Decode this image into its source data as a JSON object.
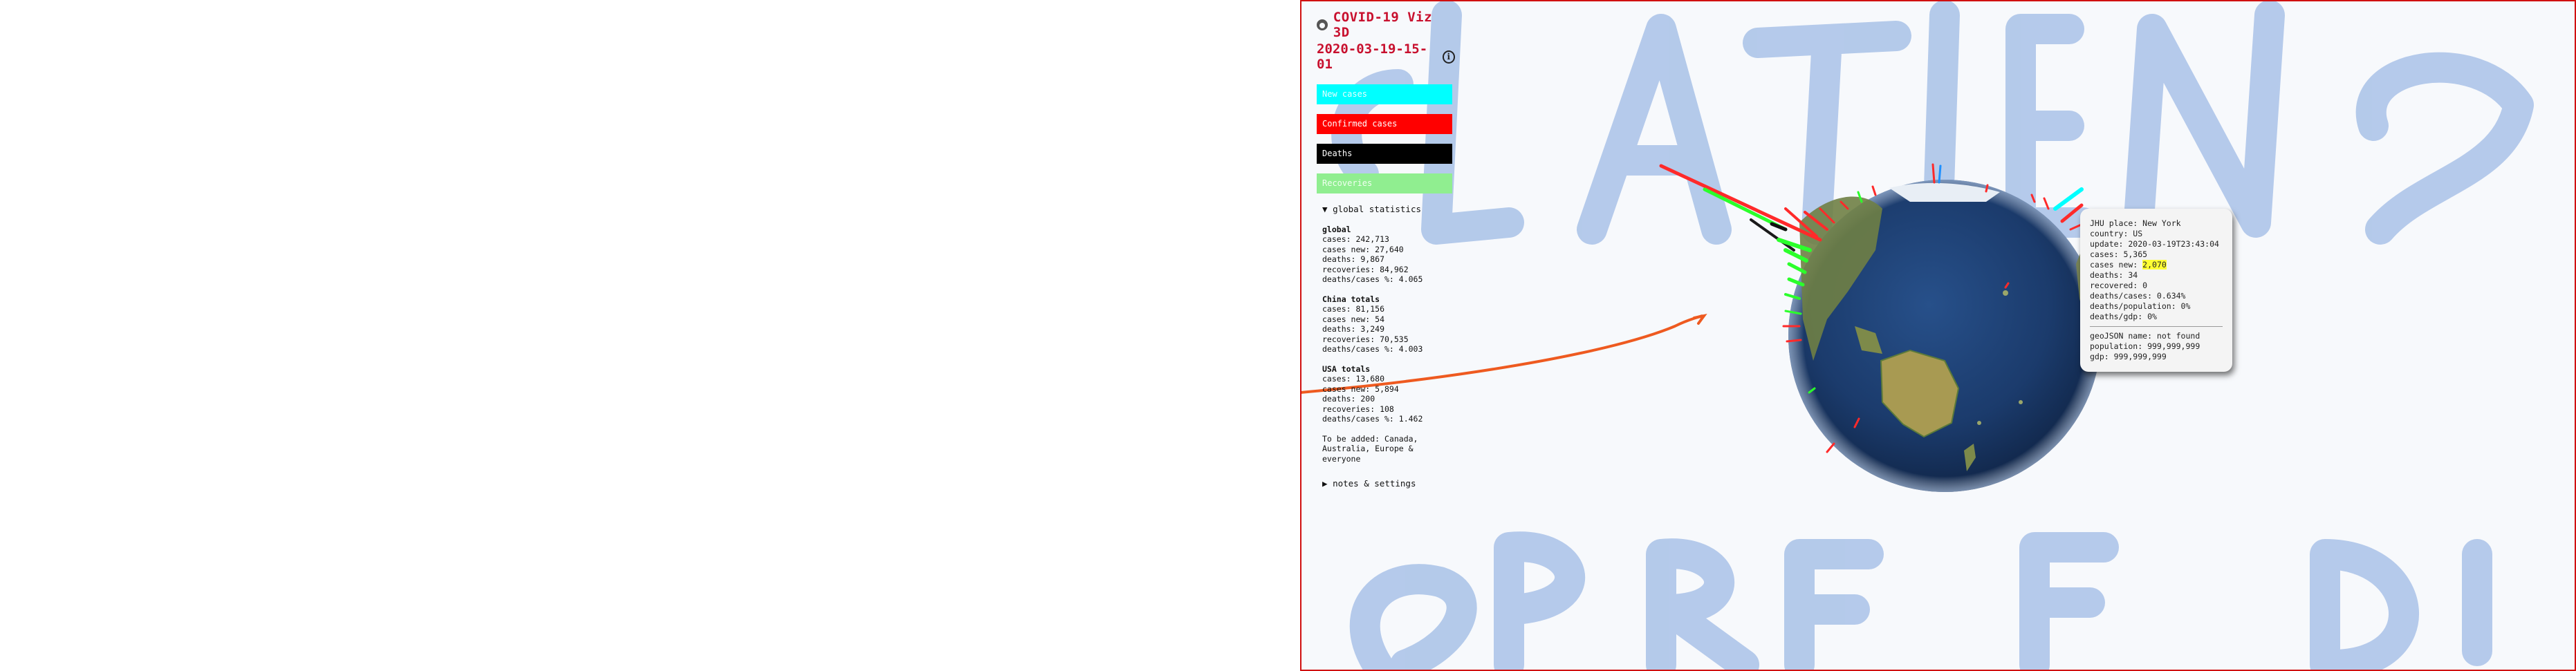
{
  "app": {
    "title": "COVID-19 Viz 3D",
    "date": "2020-03-19-15-01"
  },
  "icons": {
    "github": "github-icon",
    "info": "info-icon"
  },
  "buttons": {
    "new_cases": "New cases",
    "confirmed_cases": "Confirmed cases",
    "deaths": "Deaths",
    "recoveries": "Recoveries"
  },
  "colors": {
    "title": "#c8102e",
    "new_cases": "#00ffff",
    "confirmed_cases": "#ff0000",
    "deaths": "#000000",
    "recoveries": "#90ee90",
    "highlight": "#ffff33"
  },
  "stats": {
    "summary_label": "global statistics",
    "global": {
      "title": "global",
      "cases": "cases: 242,713",
      "cases_new": "cases new: 27,640",
      "deaths": "deaths: 9,867",
      "recoveries": "recoveries: 84,962",
      "ratio": "deaths/cases %: 4.065"
    },
    "china": {
      "title": "China totals",
      "cases": "cases: 81,156",
      "cases_new": "cases new: 54",
      "deaths": "deaths: 3,249",
      "recoveries": "recoveries: 70,535",
      "ratio": "deaths/cases %: 4.003"
    },
    "usa": {
      "title": "USA totals",
      "cases": "cases: 13,680",
      "cases_new": "cases new: 5,894",
      "deaths": "deaths: 200",
      "recoveries": "recoveries: 108",
      "ratio": "deaths/cases %: 1.462"
    },
    "todo": "To be added: Canada, Australia, Europe & everyone",
    "notes_label": "notes & settings"
  },
  "tooltip": {
    "place": "JHU place: New York",
    "country": "country: US",
    "update": "update: 2020-03-19T23:43:04",
    "cases": "cases: 5,365",
    "cases_new_label": "cases new: ",
    "cases_new_value": "2,070",
    "deaths": "deaths: 34",
    "recovered": "recovered: 0",
    "deaths_cases": "deaths/cases: 0.634%",
    "deaths_population": "deaths/population: 0%",
    "deaths_gdp": "deaths/gdp: 0%",
    "geojson": "geoJSON name: not found",
    "population": "population: 999,999,999",
    "gdp": "gdp: 999,999,999"
  }
}
